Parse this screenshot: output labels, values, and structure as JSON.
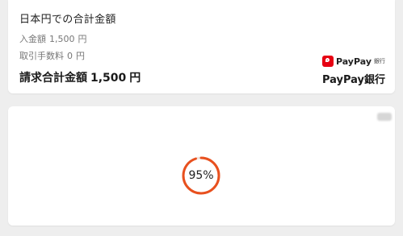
{
  "summary": {
    "title": "日本円での合計金額",
    "amount_label": "入金額",
    "amount_value": "1,500",
    "amount_unit": "円",
    "fee_label": "取引手数料",
    "fee_value": "0",
    "fee_unit": "円",
    "total_label": "請求合計金額",
    "total_value": "1,500",
    "total_unit": "円"
  },
  "brand": {
    "logo_text": "PayPay",
    "logo_sub": "銀行",
    "name": "PayPay銀行",
    "logo_color": "#e60012"
  },
  "progress": {
    "percent": 95,
    "label": "95%",
    "color": "#e8501e"
  }
}
